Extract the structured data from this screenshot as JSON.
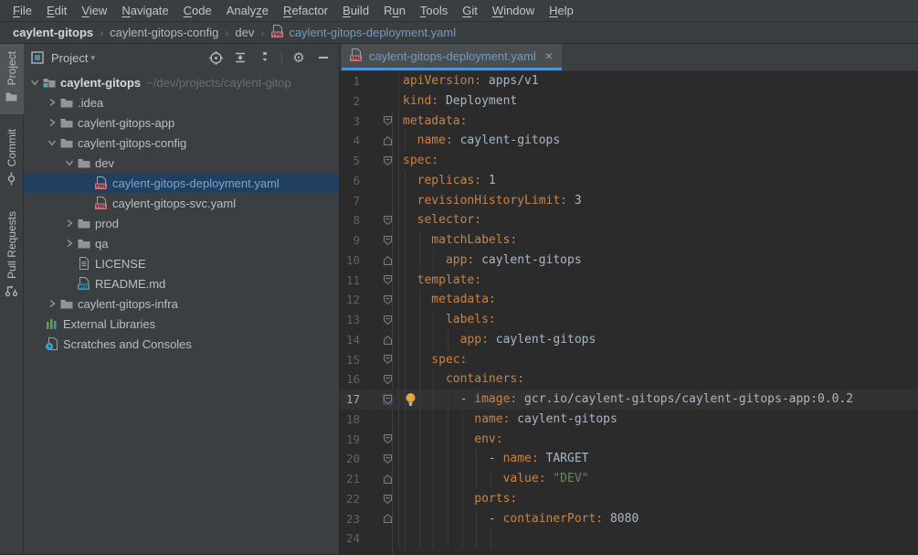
{
  "colors": {
    "accent_tab_underline": "#4f94d6",
    "tree_selection": "#223f60",
    "vcs_modified_blue": "#6f9cc4",
    "yaml_key": "#cc8242",
    "yaml_string": "#6a8759",
    "editor_text": "#a9b7c6",
    "editor_bg": "#2b2b2b",
    "panel_bg": "#3c3f41"
  },
  "menu_bar": {
    "items": [
      {
        "label": "File",
        "mnemonic_index": 0
      },
      {
        "label": "Edit",
        "mnemonic_index": 0
      },
      {
        "label": "View",
        "mnemonic_index": 0
      },
      {
        "label": "Navigate",
        "mnemonic_index": 0
      },
      {
        "label": "Code",
        "mnemonic_index": 0
      },
      {
        "label": "Analyze",
        "mnemonic_index": 5
      },
      {
        "label": "Refactor",
        "mnemonic_index": 0
      },
      {
        "label": "Build",
        "mnemonic_index": 0
      },
      {
        "label": "Run",
        "mnemonic_index": 1
      },
      {
        "label": "Tools",
        "mnemonic_index": 0
      },
      {
        "label": "Git",
        "mnemonic_index": 0
      },
      {
        "label": "Window",
        "mnemonic_index": 0
      },
      {
        "label": "Help",
        "mnemonic_index": 0
      }
    ]
  },
  "breadcrumbs": {
    "separator": "›",
    "items": [
      "caylent-gitops",
      "caylent-gitops-config",
      "dev"
    ],
    "file": {
      "label": "caylent-gitops-deployment.yaml",
      "icon": "yaml-file-icon"
    }
  },
  "tool_stripe": {
    "buttons": [
      {
        "label": "Project",
        "icon": "project-folder-icon",
        "active": true
      },
      {
        "label": "Commit",
        "icon": "commit-icon",
        "active": false
      },
      {
        "label": "Pull Requests",
        "icon": "pull-request-icon",
        "active": false
      }
    ]
  },
  "project_panel": {
    "title": "Project",
    "caret": "▾",
    "actions": [
      "locate-icon",
      "expand-all-icon",
      "collapse-all-icon",
      "settings-gear-icon",
      "hide-panel-icon"
    ],
    "tree": [
      {
        "label": "caylent-gitops",
        "suffix": "~/dev/projects/caylent-gitop",
        "level": 0,
        "chevron": "open",
        "icon": "module-folder",
        "bold": true
      },
      {
        "label": ".idea",
        "level": 1,
        "chevron": "closed",
        "icon": "folder"
      },
      {
        "label": "caylent-gitops-app",
        "level": 1,
        "chevron": "closed",
        "icon": "folder"
      },
      {
        "label": "caylent-gitops-config",
        "level": 1,
        "chevron": "open",
        "icon": "folder"
      },
      {
        "label": "dev",
        "level": 2,
        "chevron": "open",
        "icon": "folder"
      },
      {
        "label": "caylent-gitops-deployment.yaml",
        "level": 3,
        "icon": "yaml",
        "selected": true,
        "modified": true
      },
      {
        "label": "caylent-gitops-svc.yaml",
        "level": 3,
        "icon": "yaml"
      },
      {
        "label": "prod",
        "level": 2,
        "chevron": "closed",
        "icon": "folder"
      },
      {
        "label": "qa",
        "level": 2,
        "chevron": "closed",
        "icon": "folder"
      },
      {
        "label": "LICENSE",
        "level": 2,
        "icon": "license"
      },
      {
        "label": "README.md",
        "level": 2,
        "icon": "md"
      },
      {
        "label": "caylent-gitops-infra",
        "level": 1,
        "chevron": "closed",
        "icon": "folder"
      },
      {
        "label": "External Libraries",
        "level": 1,
        "icon": "libs",
        "no_chevron_slot": true
      },
      {
        "label": "Scratches and Consoles",
        "level": 1,
        "icon": "scratch",
        "no_chevron_slot": true
      }
    ]
  },
  "editor": {
    "tab": {
      "label": "caylent-gitops-deployment.yaml",
      "icon": "yaml-file-icon",
      "close": "×",
      "modified": true
    },
    "lines": [
      {
        "num": 1,
        "indent": 0,
        "fold": null,
        "seg": [
          [
            "k",
            "apiVersion:"
          ],
          [
            "p",
            " apps/v1"
          ]
        ]
      },
      {
        "num": 2,
        "indent": 0,
        "fold": null,
        "seg": [
          [
            "k",
            "kind:"
          ],
          [
            "p",
            " Deployment"
          ]
        ]
      },
      {
        "num": 3,
        "indent": 0,
        "fold": "start",
        "seg": [
          [
            "k",
            "metadata:"
          ]
        ]
      },
      {
        "num": 4,
        "indent": 2,
        "fold": "end",
        "seg": [
          [
            "k",
            "name:"
          ],
          [
            "p",
            " caylent-gitops"
          ]
        ]
      },
      {
        "num": 5,
        "indent": 0,
        "fold": "start",
        "seg": [
          [
            "k",
            "spec:"
          ]
        ]
      },
      {
        "num": 6,
        "indent": 2,
        "fold": null,
        "seg": [
          [
            "k",
            "replicas:"
          ],
          [
            "p",
            " 1"
          ]
        ]
      },
      {
        "num": 7,
        "indent": 2,
        "fold": null,
        "seg": [
          [
            "k",
            "revisionHistoryLimit:"
          ],
          [
            "p",
            " 3"
          ]
        ]
      },
      {
        "num": 8,
        "indent": 2,
        "fold": "start",
        "seg": [
          [
            "k",
            "selector:"
          ]
        ]
      },
      {
        "num": 9,
        "indent": 4,
        "fold": "start",
        "seg": [
          [
            "k",
            "matchLabels:"
          ]
        ]
      },
      {
        "num": 10,
        "indent": 6,
        "fold": "end",
        "seg": [
          [
            "k",
            "app:"
          ],
          [
            "p",
            " caylent-gitops"
          ]
        ]
      },
      {
        "num": 11,
        "indent": 2,
        "fold": "start",
        "seg": [
          [
            "k",
            "template:"
          ]
        ]
      },
      {
        "num": 12,
        "indent": 4,
        "fold": "start",
        "seg": [
          [
            "k",
            "metadata:"
          ]
        ]
      },
      {
        "num": 13,
        "indent": 6,
        "fold": "start",
        "seg": [
          [
            "k",
            "labels:"
          ]
        ]
      },
      {
        "num": 14,
        "indent": 8,
        "fold": "end",
        "seg": [
          [
            "k",
            "app:"
          ],
          [
            "p",
            " caylent-gitops"
          ]
        ]
      },
      {
        "num": 15,
        "indent": 4,
        "fold": "start",
        "seg": [
          [
            "k",
            "spec:"
          ]
        ]
      },
      {
        "num": 16,
        "indent": 6,
        "fold": "start",
        "seg": [
          [
            "k",
            "containers:"
          ]
        ]
      },
      {
        "num": 17,
        "indent": 8,
        "fold": "start",
        "current": true,
        "lightbulb": true,
        "seg": [
          [
            "p",
            "- "
          ],
          [
            "k",
            "image:"
          ],
          [
            "p",
            " gcr.io/caylent-gitops/caylent-gitops-app:0.0.2"
          ]
        ]
      },
      {
        "num": 18,
        "indent": 10,
        "fold": null,
        "seg": [
          [
            "k",
            "name:"
          ],
          [
            "p",
            " caylent-gitops"
          ]
        ]
      },
      {
        "num": 19,
        "indent": 10,
        "fold": "start",
        "seg": [
          [
            "k",
            "env:"
          ]
        ]
      },
      {
        "num": 20,
        "indent": 12,
        "fold": "start",
        "seg": [
          [
            "p",
            "- "
          ],
          [
            "k",
            "name:"
          ],
          [
            "p",
            " TARGET"
          ]
        ]
      },
      {
        "num": 21,
        "indent": 14,
        "fold": "end",
        "seg": [
          [
            "k",
            "value:"
          ],
          [
            "s",
            " \"DEV\""
          ]
        ]
      },
      {
        "num": 22,
        "indent": 10,
        "fold": "start",
        "seg": [
          [
            "k",
            "ports:"
          ]
        ]
      },
      {
        "num": 23,
        "indent": 12,
        "fold": "end",
        "seg": [
          [
            "p",
            "- "
          ],
          [
            "k",
            "containerPort:"
          ],
          [
            "p",
            " 8080"
          ]
        ]
      },
      {
        "num": 24,
        "indent": 14,
        "fold": null,
        "seg": []
      }
    ]
  }
}
